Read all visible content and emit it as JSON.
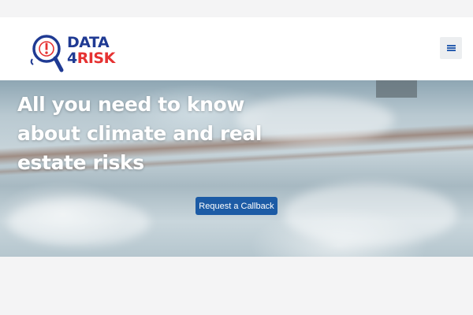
{
  "header": {
    "logo": {
      "line1": "DATA",
      "digit": "4",
      "word": "RISK",
      "icon": "magnifier-alert-icon"
    },
    "menu": {
      "icon": "hamburger-menu-icon"
    }
  },
  "hero": {
    "title": "All you need to know about climate and real estate risks",
    "cta_label": "Request a Callback"
  },
  "colors": {
    "brand_blue": "#1f3a93",
    "brand_red": "#e63232",
    "cta_blue": "#1c5ba5",
    "menu_icon": "#2a5fb0"
  }
}
